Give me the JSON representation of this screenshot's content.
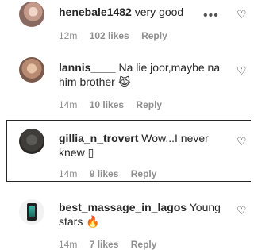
{
  "comments": [
    {
      "username": "henebale1482",
      "text": "very good",
      "time": "12m",
      "likes": "102 likes",
      "reply": "Reply",
      "more": "•••",
      "heart": "♡"
    },
    {
      "username": "lannis____",
      "text": "Na lie joor,maybe na him brother",
      "emoji": "😹",
      "time": "14m",
      "likes": "10 likes",
      "reply": "Reply",
      "heart": "♡"
    },
    {
      "username": "gillia_n_trovert",
      "text": "Wow...I never knew",
      "emoji": "▯",
      "time": "14m",
      "likes": "9 likes",
      "reply": "Reply",
      "heart": "♡"
    },
    {
      "username": "best_massage_in_lagos",
      "text": "Young stars",
      "emoji": "🔥",
      "time": "14m",
      "likes": "7 likes",
      "reply": "Reply",
      "heart": "♡"
    }
  ]
}
